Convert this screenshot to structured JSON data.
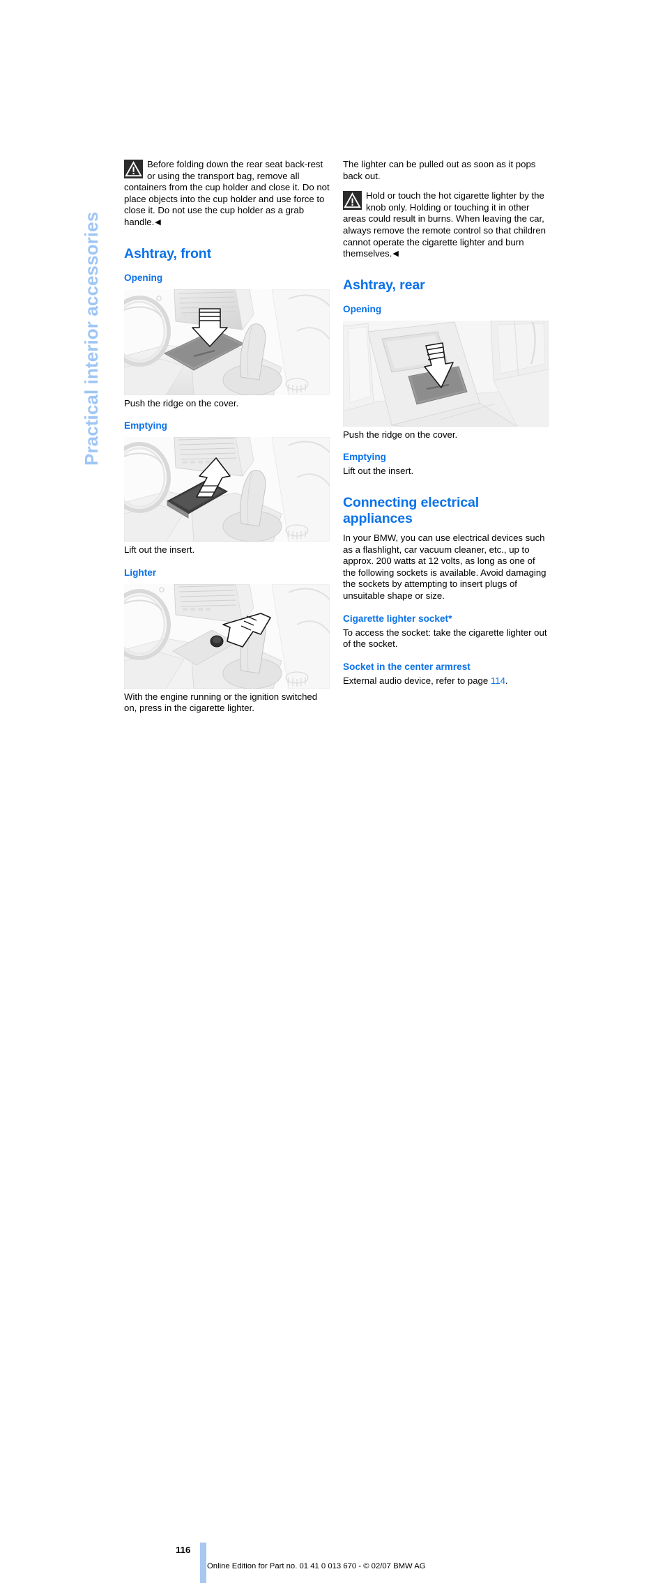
{
  "document": {
    "chapter_tab": "Practical interior accessories",
    "page_number": "116",
    "footer": "Online Edition for Part no. 01 41 0 013 670 - © 02/07 BMW AG",
    "accent_color": "#0b72e8",
    "tab_color": "#9ec6f5"
  },
  "left_column": {
    "warning_note": {
      "icon": "warning-triangle-icon",
      "text": "Before folding down the rear seat back-rest or using the transport bag, remove all containers from the cup holder and close it. Do not place objects into the cup holder and use force to close it. Do not use the cup holder as a grab handle.",
      "endmark": "◀"
    },
    "section_title": "Ashtray, front",
    "opening": {
      "heading": "Opening",
      "figure_caption": "Push the ridge on the cover.",
      "figure_alt": "front-center-console-ashtray-push-cover-illustration"
    },
    "emptying": {
      "heading": "Emptying",
      "figure_caption": "Lift out the insert.",
      "figure_alt": "front-center-console-ashtray-lift-insert-illustration"
    },
    "lighter": {
      "heading": "Lighter",
      "figure_caption": "With the engine running or the ignition switched on, press in the cigarette lighter.",
      "figure_alt": "front-center-console-cigarette-lighter-press-illustration"
    }
  },
  "right_column": {
    "intro_paragraph": "The lighter can be pulled out as soon as it pops back out.",
    "warning_note": {
      "icon": "warning-triangle-icon",
      "text_part1": "Hold or touch the hot cigarette lighter by the knob only. Holding or touching it in other areas could result in burns.",
      "text_part2": "When leaving the car, always remove the remote control so that children cannot operate the cigarette lighter and burn themselves.",
      "endmark": "◀"
    },
    "section_title": "Ashtray, rear",
    "opening": {
      "heading": "Opening",
      "figure_caption": "Push the ridge on the cover.",
      "figure_alt": "rear-center-console-ashtray-push-cover-illustration"
    },
    "emptying": {
      "heading": "Emptying",
      "body": "Lift out the insert."
    },
    "connecting": {
      "section_title": "Connecting electrical appliances",
      "body": "In your BMW, you can use electrical devices such as a flashlight, car vacuum cleaner, etc., up to approx. 200 watts at 12 volts, as long as one of the following sockets is available. Avoid damaging the sockets by attempting to insert plugs of unsuitable shape or size."
    },
    "cigarette_socket": {
      "heading": "Cigarette lighter socket*",
      "body": "To access the socket: take the cigarette lighter out of the socket."
    },
    "armrest_socket": {
      "heading": "Socket in the center armrest",
      "body_before": "External audio device, refer to page ",
      "page_ref": "114",
      "body_after": "."
    }
  }
}
